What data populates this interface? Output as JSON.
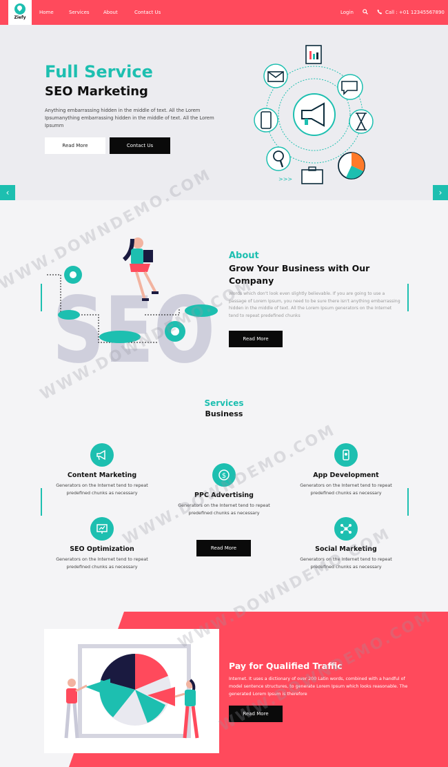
{
  "colors": {
    "accent": "#1dbfb0",
    "brand": "#ff4a5c",
    "dark": "#0a0a0a"
  },
  "header": {
    "logo_text": "Ziefy",
    "nav": [
      "Home",
      "Services",
      "About",
      "Contact Us"
    ],
    "login": "Login",
    "call": "Call : +01 12345567890"
  },
  "hero": {
    "title": "Full Service",
    "subtitle": "SEO Marketing",
    "text": "Anything embarrassing hidden in the middle of text. All the Lorem Ipsumanything embarrassing hidden in the middle of text. All the Lorem Ipsumm",
    "read_more": "Read More",
    "contact_us": "Contact Us",
    "prev": "‹",
    "next": "›"
  },
  "about": {
    "kicker": "About",
    "title": "Grow Your Business with Our Company",
    "text": "Words which don't look even slightly believable. If you are going to use a passage of Lorem Ipsum, you need to be sure there isn't anything embarrassing hidden in the middle of text. All the Lorem Ipsum generators on the Internet tend to repeat predefined chunks",
    "read_more": "Read More",
    "illustration_text": "SEO"
  },
  "services": {
    "kicker": "Services",
    "title": "Business",
    "read_more": "Read More",
    "items": [
      {
        "name": "Content Marketing",
        "desc": "Generators on the Internet tend to repeat predefined chunks as necessary",
        "icon": "megaphone-icon"
      },
      {
        "name": "PPC Advertising",
        "desc": "Generators on the Internet tend to repeat predefined chunks as necessary",
        "icon": "dollar-coin-icon"
      },
      {
        "name": "App Development",
        "desc": "Generators on the Internet tend to repeat predefined chunks as necessary",
        "icon": "app-phone-icon"
      },
      {
        "name": "SEO Optimization",
        "desc": "Generators on the Internet tend to repeat predefined chunks as necessary",
        "icon": "monitor-chart-icon"
      },
      {
        "name": "Social Marketing",
        "desc": "Generators on the Internet tend to repeat predefined chunks as necessary",
        "icon": "social-network-icon"
      }
    ]
  },
  "traffic": {
    "title": "Pay for Qualified Traffic",
    "text": "Internet. It uses a dictionary of over 200 Latin words, combined with a handful of model sentence structures, to generate Lorem Ipsum which looks reasonable. The generated Lorem Ipsum is therefore",
    "read_more": "Read More"
  },
  "watermark": "WWW.DOWNDEMO.COM"
}
